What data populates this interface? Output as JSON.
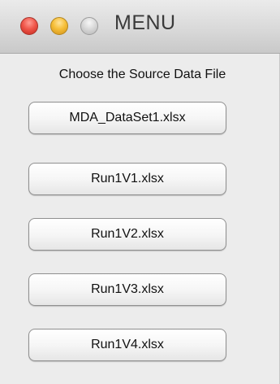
{
  "window": {
    "title": "MENU",
    "controls": {
      "close": "close-icon",
      "minimize": "minimize-icon",
      "zoom": "zoom-icon"
    }
  },
  "main": {
    "prompt": "Choose the Source Data File",
    "files": [
      {
        "label": "MDA_DataSet1.xlsx"
      },
      {
        "label": "Run1V1.xlsx"
      },
      {
        "label": "Run1V2.xlsx"
      },
      {
        "label": "Run1V3.xlsx"
      },
      {
        "label": "Run1V4.xlsx"
      }
    ]
  },
  "colors": {
    "close": "#f0574b",
    "minimize": "#f6bf39",
    "zoom": "#d6d6d6",
    "window_bg": "#ececec"
  }
}
